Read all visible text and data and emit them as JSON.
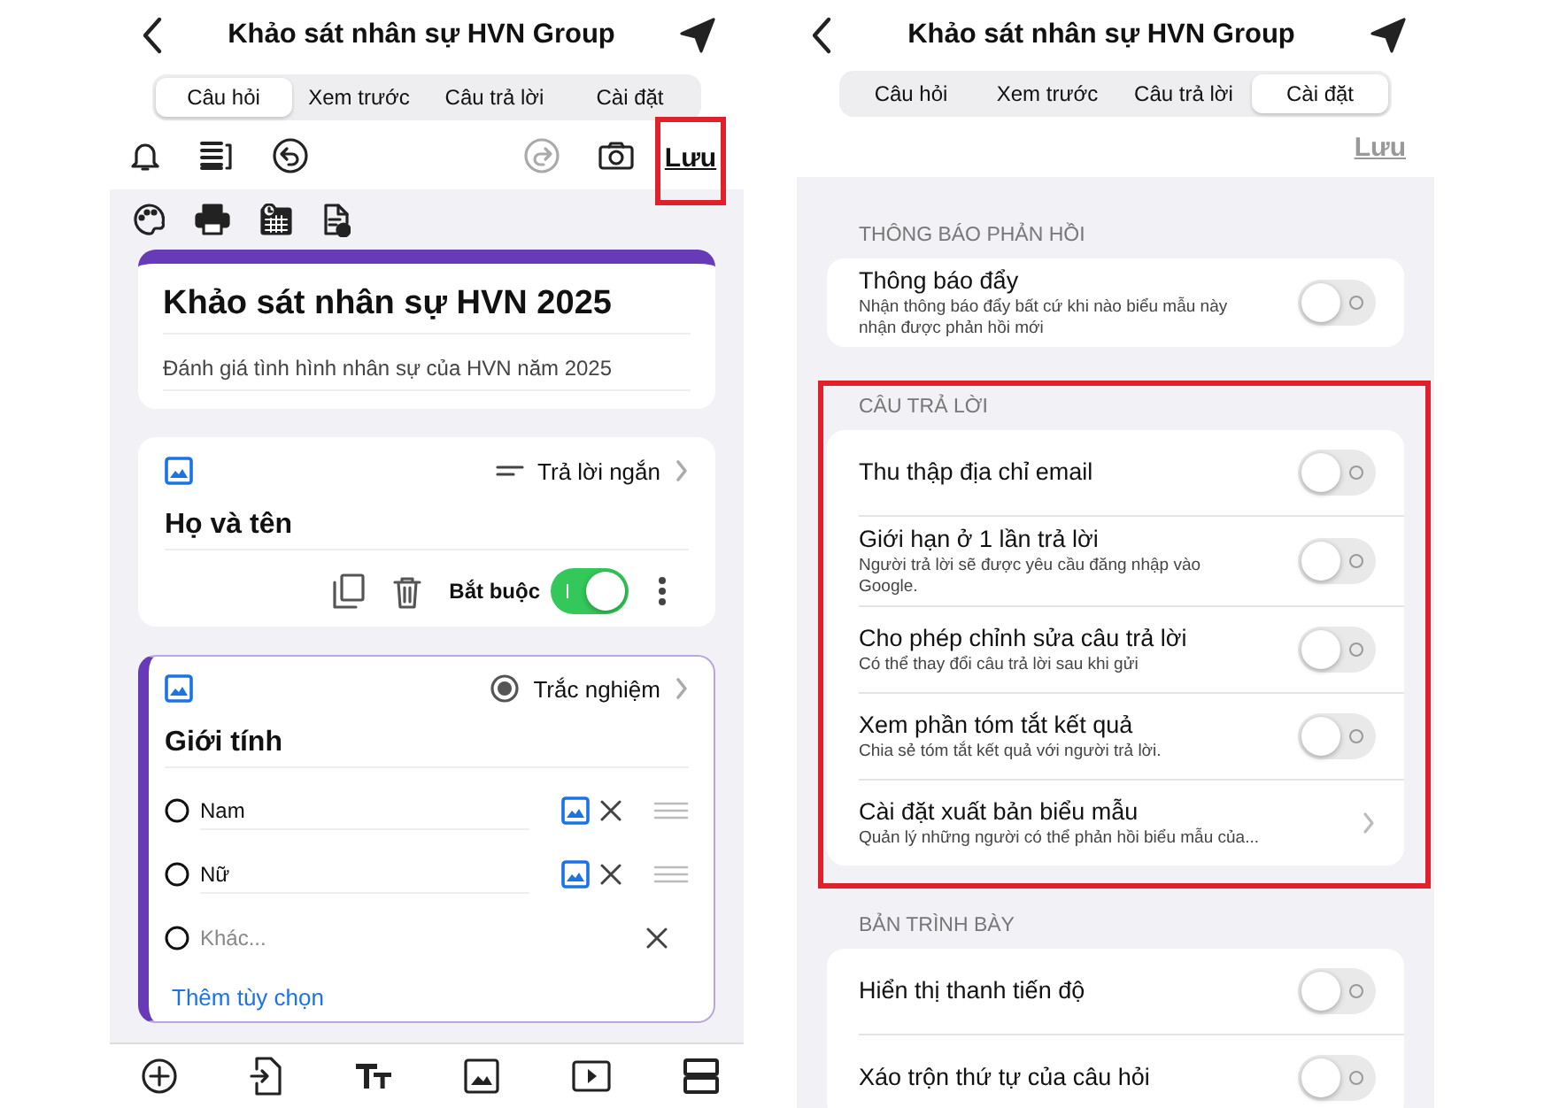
{
  "left_screen": {
    "title": "Khảo sát nhân sự HVN Group",
    "tabs": [
      {
        "label": "Câu hỏi",
        "selected": true
      },
      {
        "label": "Xem trước",
        "selected": false
      },
      {
        "label": "Câu trả lời",
        "selected": false
      },
      {
        "label": "Cài đặt",
        "selected": false
      }
    ],
    "save": {
      "label": "Lưu",
      "highlighted": true,
      "disabled": false
    },
    "form": {
      "title": "Khảo sát nhân sự HVN 2025",
      "description": "Đánh giá tình hình nhân sự của HVN năm 2025"
    },
    "questions": [
      {
        "kind": "short",
        "type_label": "Trả lời ngắn",
        "title": "Họ và tên",
        "active": false,
        "required_label": "Bắt buộc",
        "required": true
      },
      {
        "kind": "choice",
        "type_label": "Trắc nghiệm",
        "title": "Giới tính",
        "active": true,
        "options": [
          {
            "label": "Nam"
          },
          {
            "label": "Nữ"
          }
        ],
        "other_placeholder": "Khác...",
        "add_option": "Thêm tùy chọn"
      }
    ]
  },
  "right_screen": {
    "title": "Khảo sát nhân sự HVN Group",
    "tabs": [
      {
        "label": "Câu hỏi",
        "selected": false
      },
      {
        "label": "Xem trước",
        "selected": false
      },
      {
        "label": "Câu trả lời",
        "selected": false
      },
      {
        "label": "Cài đặt",
        "selected": true
      }
    ],
    "save": {
      "label": "Lưu",
      "disabled": true
    },
    "sections": [
      {
        "heading": "THÔNG BÁO PHẢN HỒI",
        "highlighted": false,
        "rows": [
          {
            "kind": "toggle",
            "title": "Thông báo đẩy",
            "subtitle": "Nhận thông báo đẩy bất cứ khi nào biểu mẫu này nhận được phản hồi mới",
            "on": false
          }
        ]
      },
      {
        "heading": "CÂU TRẢ LỜI",
        "highlighted": true,
        "rows": [
          {
            "kind": "toggle",
            "title": "Thu thập địa chỉ email",
            "on": false
          },
          {
            "kind": "toggle",
            "title": "Giới hạn ở 1 lần trả lời",
            "subtitle": "Người trả lời sẽ được yêu cầu đăng nhập vào Google.",
            "on": false
          },
          {
            "kind": "toggle",
            "title": "Cho phép chỉnh sửa câu trả lời",
            "subtitle": "Có thể thay đổi câu trả lời sau khi gửi",
            "on": false
          },
          {
            "kind": "toggle",
            "title": "Xem phần tóm tắt kết quả",
            "subtitle": "Chia sẻ tóm tắt kết quả với người trả lời.",
            "on": false
          },
          {
            "kind": "link",
            "title": "Cài đặt xuất bản biểu mẫu",
            "subtitle": "Quản lý những người có thể phản hồi biểu mẫu của..."
          }
        ]
      },
      {
        "heading": "BẢN TRÌNH BÀY",
        "highlighted": false,
        "rows": [
          {
            "kind": "toggle",
            "title": "Hiển thị thanh tiến độ",
            "on": false
          },
          {
            "kind": "toggle",
            "title": "Xáo trộn thứ tự của câu hỏi",
            "on": false
          }
        ]
      }
    ]
  }
}
